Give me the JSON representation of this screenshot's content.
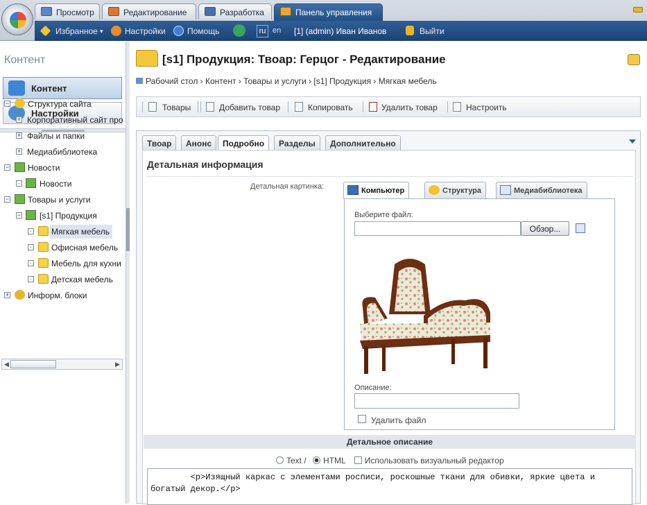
{
  "top_tabs": [
    {
      "label": "Просмотр"
    },
    {
      "label": "Редактирование"
    },
    {
      "label": "Разработка"
    },
    {
      "label": "Панель управления"
    }
  ],
  "panel_bar": {
    "favorites": "Избранное",
    "settings": "Настройки",
    "help": "Помощь",
    "lang_ru": "ru",
    "lang_en": "en",
    "user": "[1] (admin) Иван Иванов",
    "logout": "Выйти"
  },
  "left": {
    "title": "Контент",
    "buttons": [
      {
        "label": "Контент"
      },
      {
        "label": "Настройки"
      }
    ],
    "tree": [
      {
        "label": "Структура сайта",
        "exp": "−"
      },
      {
        "label": "Корпоративный сайт про",
        "exp": "+"
      },
      {
        "label": "Файлы и папки",
        "exp": "+"
      },
      {
        "label": "Медиабиблиотека",
        "exp": "+"
      },
      {
        "label": "Новости",
        "exp": "−"
      },
      {
        "label": "Новости",
        "exp": "·"
      },
      {
        "label": "Товары и услуги",
        "exp": "−"
      },
      {
        "label": "[s1] Продукция",
        "exp": "−"
      },
      {
        "label": "Мягкая мебель",
        "exp": "·"
      },
      {
        "label": "Офисная мебель",
        "exp": "·"
      },
      {
        "label": "Мебель для кухни",
        "exp": "·"
      },
      {
        "label": "Детская мебель",
        "exp": "·"
      },
      {
        "label": "Информ. блоки",
        "exp": "+"
      }
    ]
  },
  "page": {
    "title": "[s1] Продукция: Твоар: Герцог - Редактирование",
    "breadcrumb": "Рабочий стол › Контент › Товары и услуги › [s1] Продукция › Мягкая мебель"
  },
  "toolbar": {
    "items": [
      {
        "label": "Товары"
      },
      {
        "label": "Добавить товар"
      },
      {
        "label": "Копировать"
      },
      {
        "label": "Удалить товар"
      },
      {
        "label": "Настроить"
      }
    ]
  },
  "form_tabs": [
    {
      "label": "Твоар"
    },
    {
      "label": "Анонс"
    },
    {
      "label": "Подробно"
    },
    {
      "label": "Разделы"
    },
    {
      "label": "Дополнительно"
    }
  ],
  "form": {
    "section_title": "Детальная информация",
    "detail_picture_label": "Детальная картинка:",
    "inner_tabs": [
      {
        "label": "Компьютер"
      },
      {
        "label": "Структура"
      },
      {
        "label": "Медиабиблиотека"
      }
    ],
    "choose_file_label": "Выберите файл:",
    "browse_button": "Обзор...",
    "description_label": "Описание:",
    "delete_file_label": "Удалить файл",
    "detail_desc_header": "Детальное описание",
    "mode_text": "Text /",
    "mode_html": "HTML",
    "visual_editor_label": "Использовать визуальный редактор",
    "content": "        <p>Изящный каркас с элементами росписи, роскошные ткани для обивки, яркие цвета и богатый декор.</p>"
  }
}
